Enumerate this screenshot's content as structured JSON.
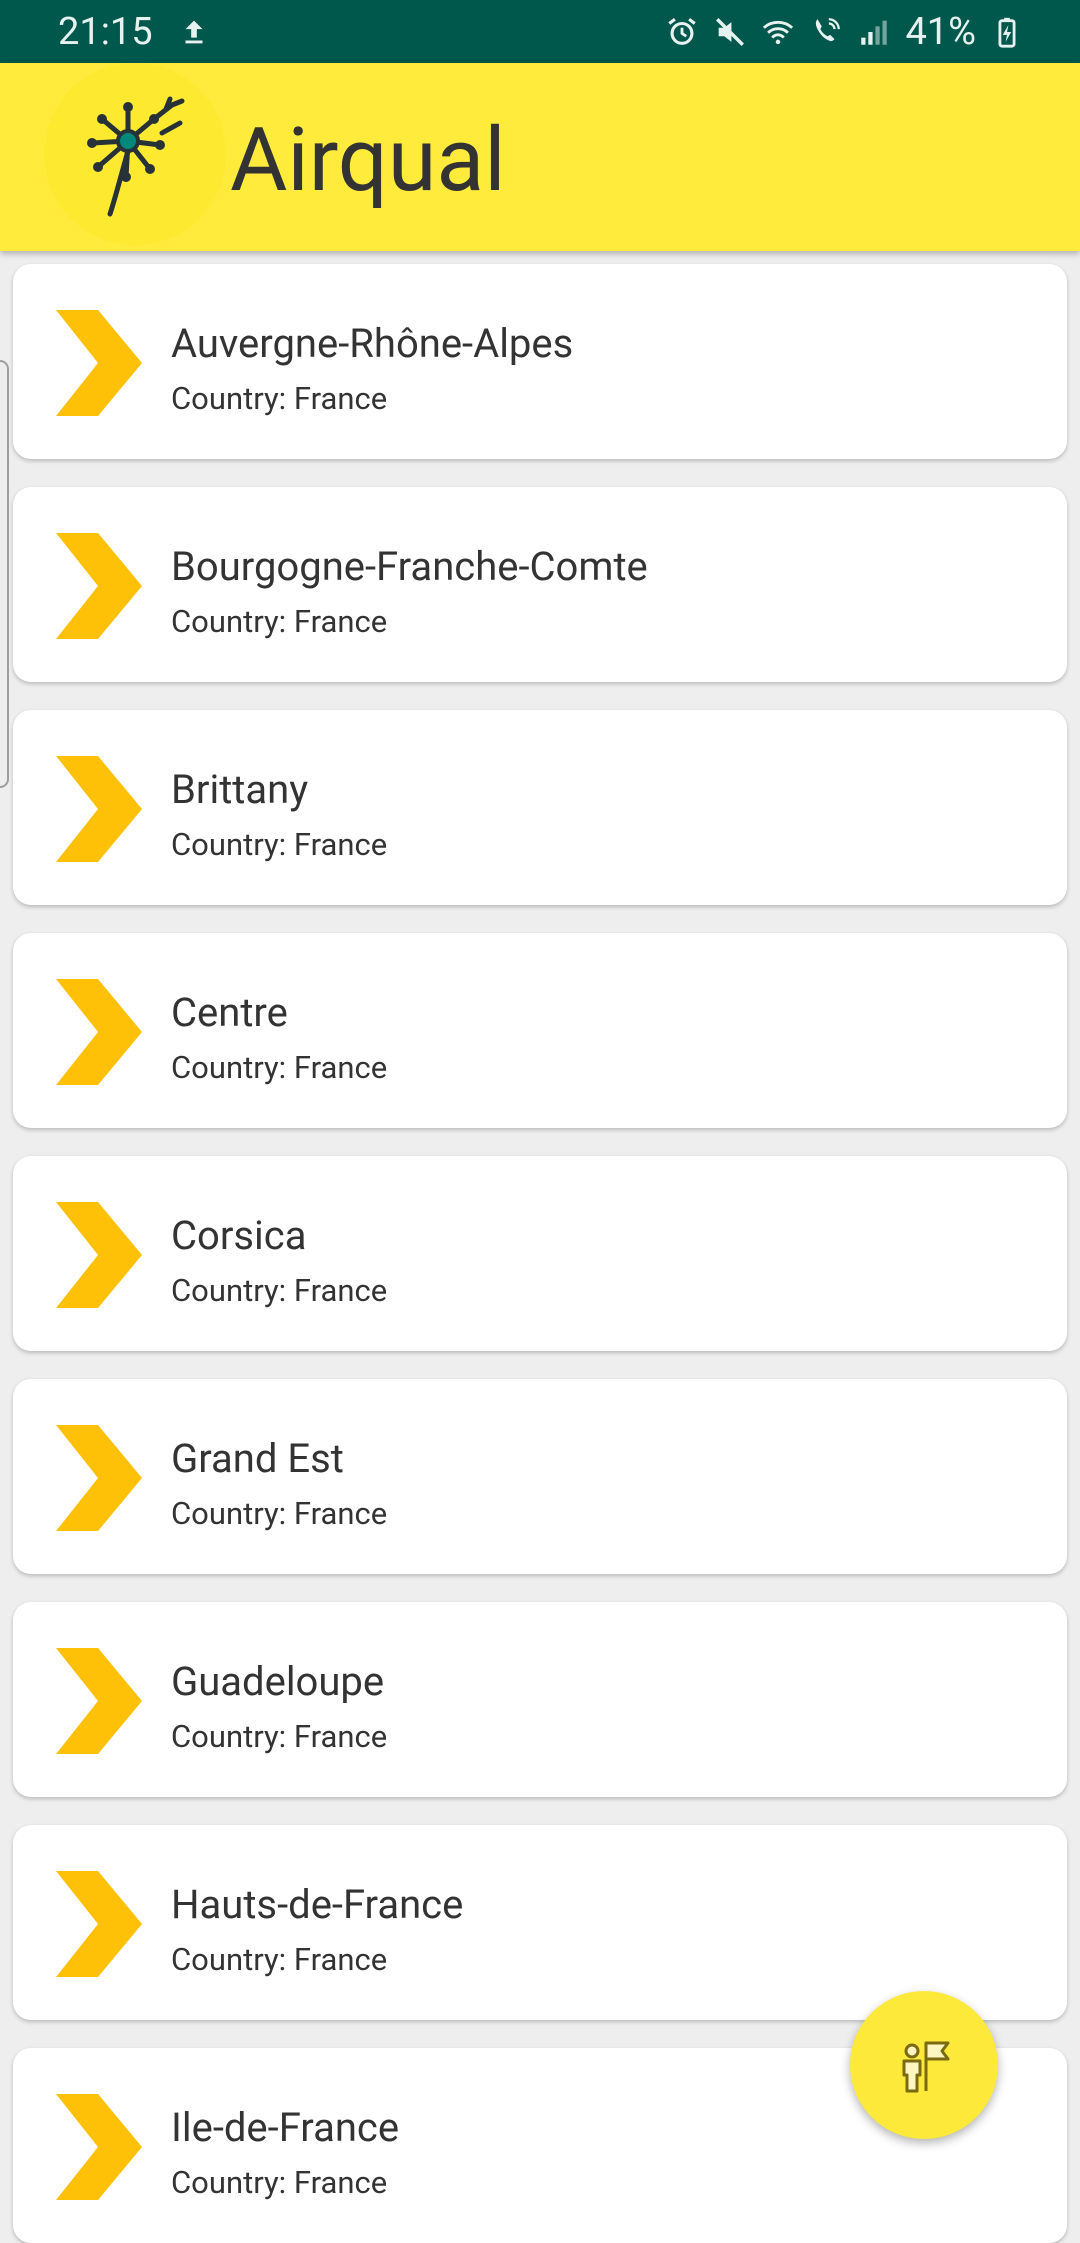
{
  "status_bar": {
    "time": "21:15",
    "battery": "41%",
    "icons": [
      "upload-icon",
      "alarm-icon",
      "mute-icon",
      "wifi-icon",
      "wifi-calling-icon",
      "signal-icon",
      "battery-charging-icon"
    ]
  },
  "app_bar": {
    "title": "Airqual",
    "logo_icon": "dandelion-logo-icon"
  },
  "regions": [
    {
      "name": "Auvergne-Rhône-Alpes",
      "subtitle": "Country: France"
    },
    {
      "name": "Bourgogne-Franche-Comte",
      "subtitle": "Country: France"
    },
    {
      "name": "Brittany",
      "subtitle": "Country: France"
    },
    {
      "name": "Centre",
      "subtitle": "Country: France"
    },
    {
      "name": "Corsica",
      "subtitle": "Country: France"
    },
    {
      "name": "Grand Est",
      "subtitle": "Country: France"
    },
    {
      "name": "Guadeloupe",
      "subtitle": "Country: France"
    },
    {
      "name": "Hauts-de-France",
      "subtitle": "Country: France"
    },
    {
      "name": "Ile-de-France",
      "subtitle": "Country: France"
    }
  ],
  "fab": {
    "icon": "person-flag-icon"
  },
  "colors": {
    "status_bar": "#00574b",
    "app_bar": "#ffeb3b",
    "chevron": "#ffc107",
    "fab": "#fde93a"
  }
}
